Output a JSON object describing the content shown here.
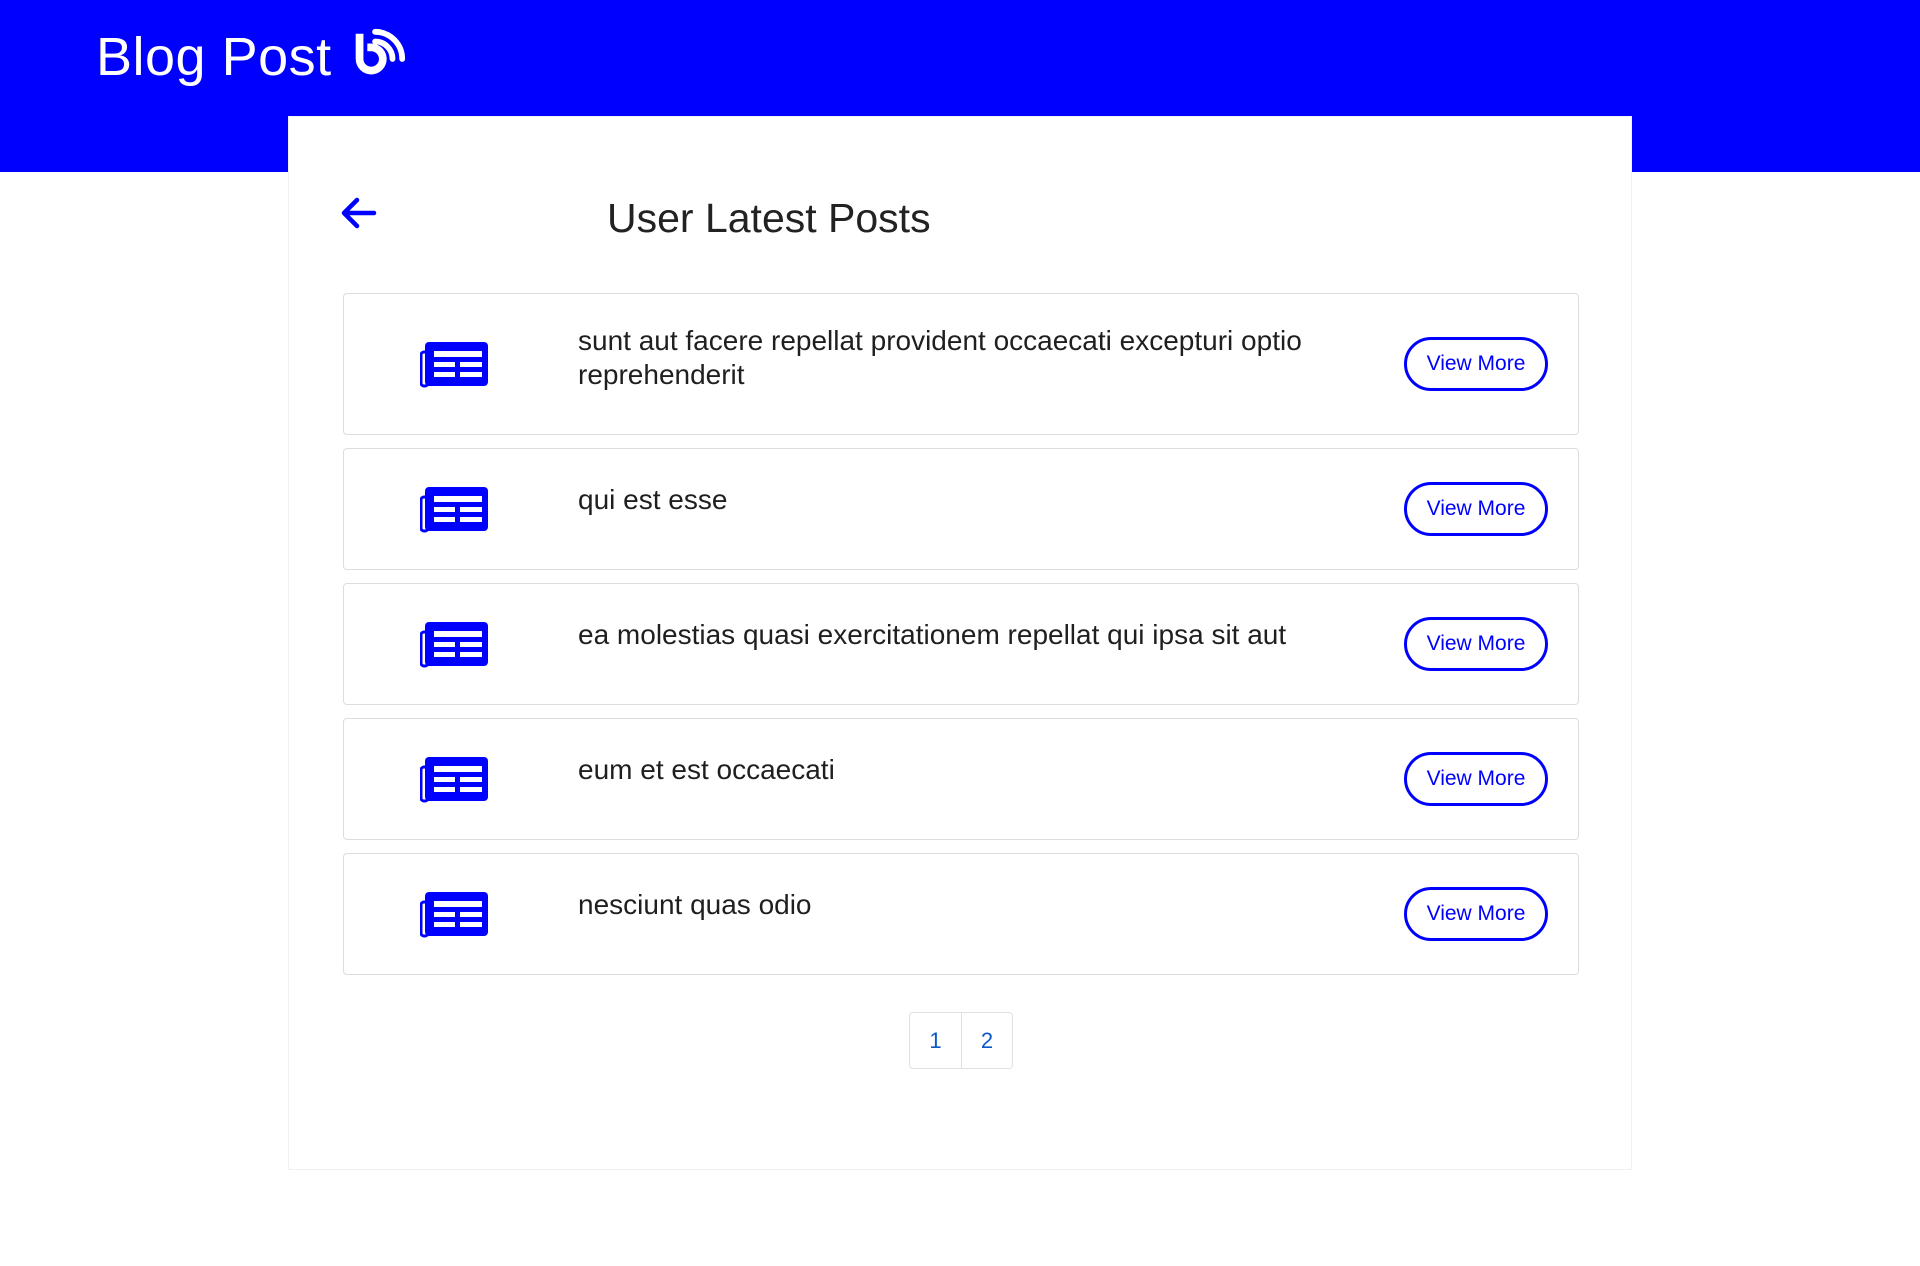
{
  "header": {
    "title": "Blog Post",
    "logo_icon": "blog-rss-icon",
    "background_color": "#0000ff"
  },
  "main": {
    "back_icon": "arrow-left-icon",
    "title": "User Latest Posts",
    "posts": [
      {
        "title": "sunt aut facere repellat provident occaecati excepturi optio reprehenderit",
        "button": "View More",
        "icon": "newspaper-icon"
      },
      {
        "title": "qui est esse",
        "button": "View More",
        "icon": "newspaper-icon"
      },
      {
        "title": "ea molestias quasi exercitationem repellat qui ipsa sit aut",
        "button": "View More",
        "icon": "newspaper-icon"
      },
      {
        "title": "eum et est occaecati",
        "button": "View More",
        "icon": "newspaper-icon"
      },
      {
        "title": "nesciunt quas odio",
        "button": "View More",
        "icon": "newspaper-icon"
      }
    ],
    "accent_color": "#0000ff"
  },
  "pagination": {
    "pages": [
      "1",
      "2"
    ]
  }
}
